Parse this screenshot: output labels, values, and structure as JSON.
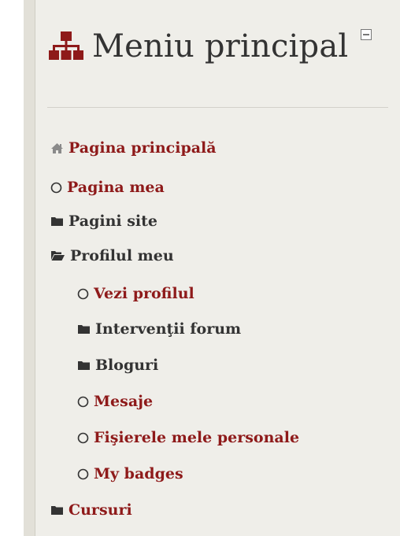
{
  "block": {
    "title": "Meniu principal",
    "header_icon": "sitemap-icon",
    "collapse_icon": "collapse-icon"
  },
  "nav": {
    "items": [
      {
        "label": "Pagina principală",
        "icon": "home-icon",
        "level": 0,
        "link": true,
        "active": true
      },
      {
        "label": "Pagina mea",
        "icon": "circle-icon",
        "level": 0,
        "link": true
      },
      {
        "label": "Pagini site",
        "icon": "folder-icon",
        "level": 0,
        "link": false
      },
      {
        "label": "Profilul meu",
        "icon": "folder-open-icon",
        "level": 0,
        "link": false
      },
      {
        "label": "Vezi profilul",
        "icon": "circle-icon",
        "level": 1,
        "link": true
      },
      {
        "label": "Intervenţii forum",
        "icon": "folder-icon",
        "level": 1,
        "link": false
      },
      {
        "label": "Bloguri",
        "icon": "folder-icon",
        "level": 1,
        "link": false
      },
      {
        "label": "Mesaje",
        "icon": "circle-icon",
        "level": 1,
        "link": true
      },
      {
        "label": "Fişierele mele personale",
        "icon": "circle-icon",
        "level": 1,
        "link": true
      },
      {
        "label": "My badges",
        "icon": "circle-icon",
        "level": 1,
        "link": true
      },
      {
        "label": "Cursuri",
        "icon": "folder-icon",
        "level": 0,
        "link": false
      }
    ]
  },
  "colors": {
    "link": "#8e1a1a",
    "text": "#333333",
    "panel": "#efeee9",
    "accent_icon": "#8e1a1a"
  }
}
